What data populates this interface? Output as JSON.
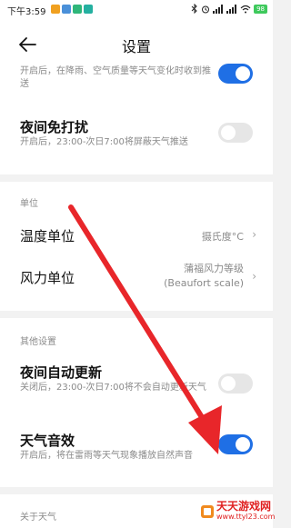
{
  "status_bar": {
    "time": "下午3:59",
    "battery": "98",
    "app_icon_colors": [
      "#f0a020",
      "#4a90d9",
      "#2fb67a",
      "#24b0a0"
    ]
  },
  "header": {
    "title": "设置",
    "back_icon": "arrow-left-icon"
  },
  "rows": {
    "weather_change_push": {
      "description": "开启后，在降雨、空气质量等天气变化时收到推送",
      "toggle": "on"
    },
    "night_dnd": {
      "title": "夜间免打扰",
      "description": "开启后，23:00-次日7:00将屏蔽天气推送",
      "toggle": "off"
    },
    "temperature_unit": {
      "title": "温度单位",
      "value": "摄氏度°C"
    },
    "wind_unit": {
      "title": "风力单位",
      "value_line1": "蒲福风力等级",
      "value_line2": "(Beaufort scale)"
    },
    "night_auto_update": {
      "title": "夜间自动更新",
      "description": "关闭后，23:00-次日7:00将不会自动更新天气",
      "toggle": "off"
    },
    "weather_sound": {
      "title": "天气音效",
      "description": "开启后，将在雷雨等天气现象播放自然声音",
      "toggle": "on"
    }
  },
  "sections": {
    "units": "单位",
    "other": "其他设置",
    "about": "关于天气"
  },
  "watermark": {
    "title": "天天游戏网",
    "url": "www.ttyl23.com"
  },
  "colors": {
    "accent": "#1f6fe5",
    "arrow": "#e8262a"
  }
}
